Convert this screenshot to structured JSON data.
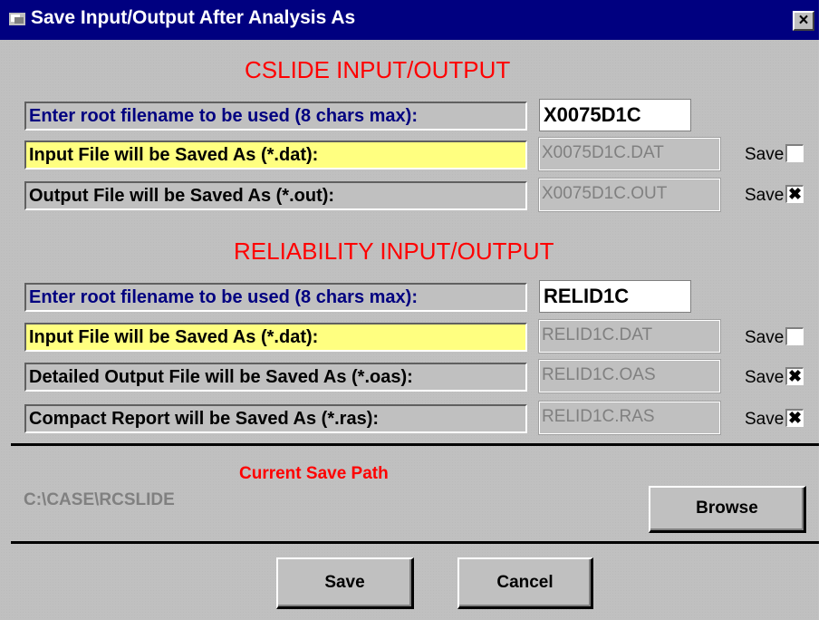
{
  "window": {
    "title": "Save Input/Output After Analysis As",
    "close_label": "×"
  },
  "cslide": {
    "section_title": "CSLIDE INPUT/OUTPUT",
    "root_label": "Enter root filename to be used  (8 chars max):",
    "root_value": "X0075D1C",
    "rows": [
      {
        "label": "Input File will be Saved As (*.dat):",
        "filename": "X0075D1C.DAT",
        "save_label": "Save",
        "checked": false
      },
      {
        "label": "Output File will be Saved As (*.out):",
        "filename": "X0075D1C.OUT",
        "save_label": "Save",
        "checked": true
      }
    ]
  },
  "reliability": {
    "section_title": "RELIABILITY INPUT/OUTPUT",
    "root_label": "Enter root filename to be used  (8 chars max):",
    "root_value": "RELID1C",
    "rows": [
      {
        "label": "Input File will be Saved As (*.dat):",
        "filename": "RELID1C.DAT",
        "save_label": "Save",
        "checked": false
      },
      {
        "label": "Detailed Output File will be Saved As (*.oas):",
        "filename": "RELID1C.OAS",
        "save_label": "Save",
        "checked": true
      },
      {
        "label": "Compact Report will be Saved As (*.ras):",
        "filename": "RELID1C.RAS",
        "save_label": "Save",
        "checked": true
      }
    ]
  },
  "path": {
    "title": "Current Save Path",
    "value": "C:\\CASE\\RCSLIDE",
    "browse_label": "Browse"
  },
  "buttons": {
    "save_label": "Save",
    "cancel_label": "Cancel"
  },
  "check_glyph": "✖",
  "colors": {
    "titlebar": "#000080",
    "section_title": "#ff0000",
    "label_blue": "#000080",
    "highlight_yellow": "#ffff80",
    "face": "#c0c0c0"
  }
}
